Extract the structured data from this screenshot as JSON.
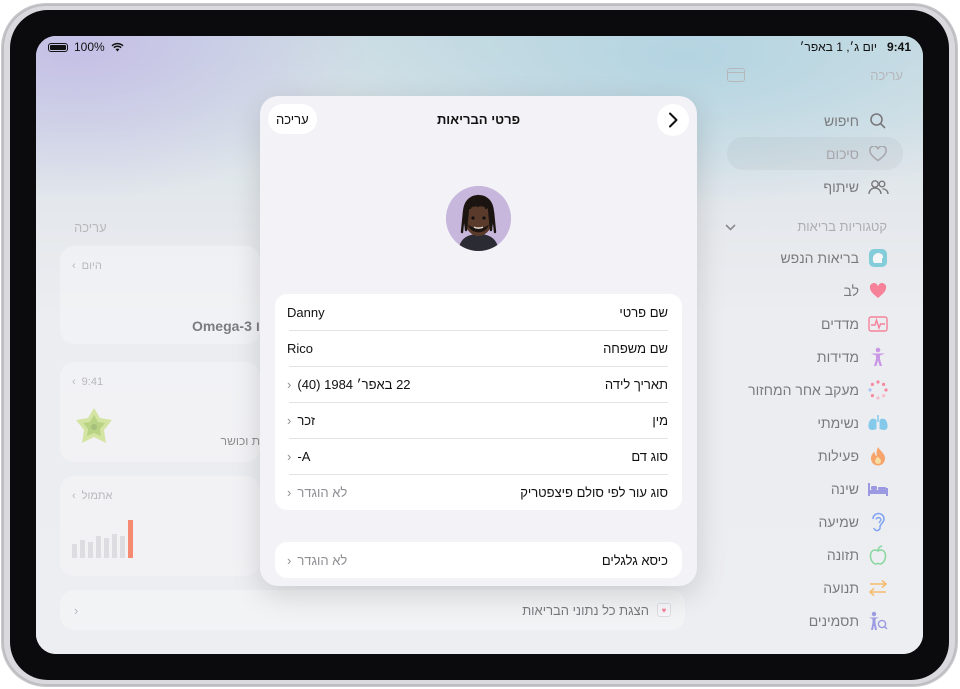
{
  "status": {
    "time": "9:41",
    "date": "יום ג׳, 1 באפר׳",
    "battery": "100%"
  },
  "sidebar": {
    "edit_label": "עריכה",
    "nav": [
      {
        "label": "חיפוש",
        "icon": "search-icon"
      },
      {
        "label": "סיכום",
        "icon": "heart-outline-icon",
        "selected": true
      },
      {
        "label": "שיתוף",
        "icon": "people-icon"
      }
    ],
    "section_label": "קטגוריות בריאות",
    "categories": [
      {
        "label": "בריאות הנפש",
        "icon": "mind-icon",
        "color": "#2fb3c6"
      },
      {
        "label": "לב",
        "icon": "heart-icon",
        "color": "#ff2d55"
      },
      {
        "label": "מדדים",
        "icon": "vitals-icon",
        "color": "#ff2d55"
      },
      {
        "label": "מדידות",
        "icon": "body-figure-icon",
        "color": "#af52de"
      },
      {
        "label": "מעקב אחר המחזור",
        "icon": "cycle-icon",
        "color": "#ff375f"
      },
      {
        "label": "נשימתי",
        "icon": "lungs-icon",
        "color": "#32ade6"
      },
      {
        "label": "פעילות",
        "icon": "flame-icon",
        "color": "#ff6a00"
      },
      {
        "label": "שינה",
        "icon": "bed-icon",
        "color": "#5856d6"
      },
      {
        "label": "שמיעה",
        "icon": "ear-icon",
        "color": "#2f6cf6"
      },
      {
        "label": "תזונה",
        "icon": "apple-icon",
        "color": "#34c759"
      },
      {
        "label": "תנועה",
        "icon": "arrows-icon",
        "color": "#ff9500"
      },
      {
        "label": "תסמינים",
        "icon": "symptoms-icon",
        "color": "#5856d6"
      }
    ]
  },
  "summary": {
    "edit_label": "עריכה",
    "card1": {
      "meta": "היום",
      "title": "Omega-3 ו"
    },
    "card2": {
      "meta": "9:41",
      "text": "ת וכושר"
    },
    "card3": {
      "meta": "אתמול"
    },
    "show_all": "הצגת כל נתוני הבריאות"
  },
  "sheet": {
    "title": "פרטי הבריאות",
    "edit_label": "עריכה",
    "rows": [
      {
        "label": "שם פרטי",
        "value": "Danny",
        "chevron": false
      },
      {
        "label": "שם משפחה",
        "value": "Rico",
        "chevron": false
      },
      {
        "label": "תאריך לידה",
        "value": "22 באפר׳ 1984 (40)",
        "chevron": true
      },
      {
        "label": "מין",
        "value": "זכר",
        "chevron": true
      },
      {
        "label": "סוג דם",
        "value": "A-",
        "chevron": true
      },
      {
        "label": "סוג עור לפי סולם פיצפטריק",
        "value": "לא הוגדר",
        "chevron": true,
        "muted": true
      }
    ],
    "wheelchair": {
      "label": "כיסא גלגלים",
      "value": "לא הוגדר"
    }
  }
}
